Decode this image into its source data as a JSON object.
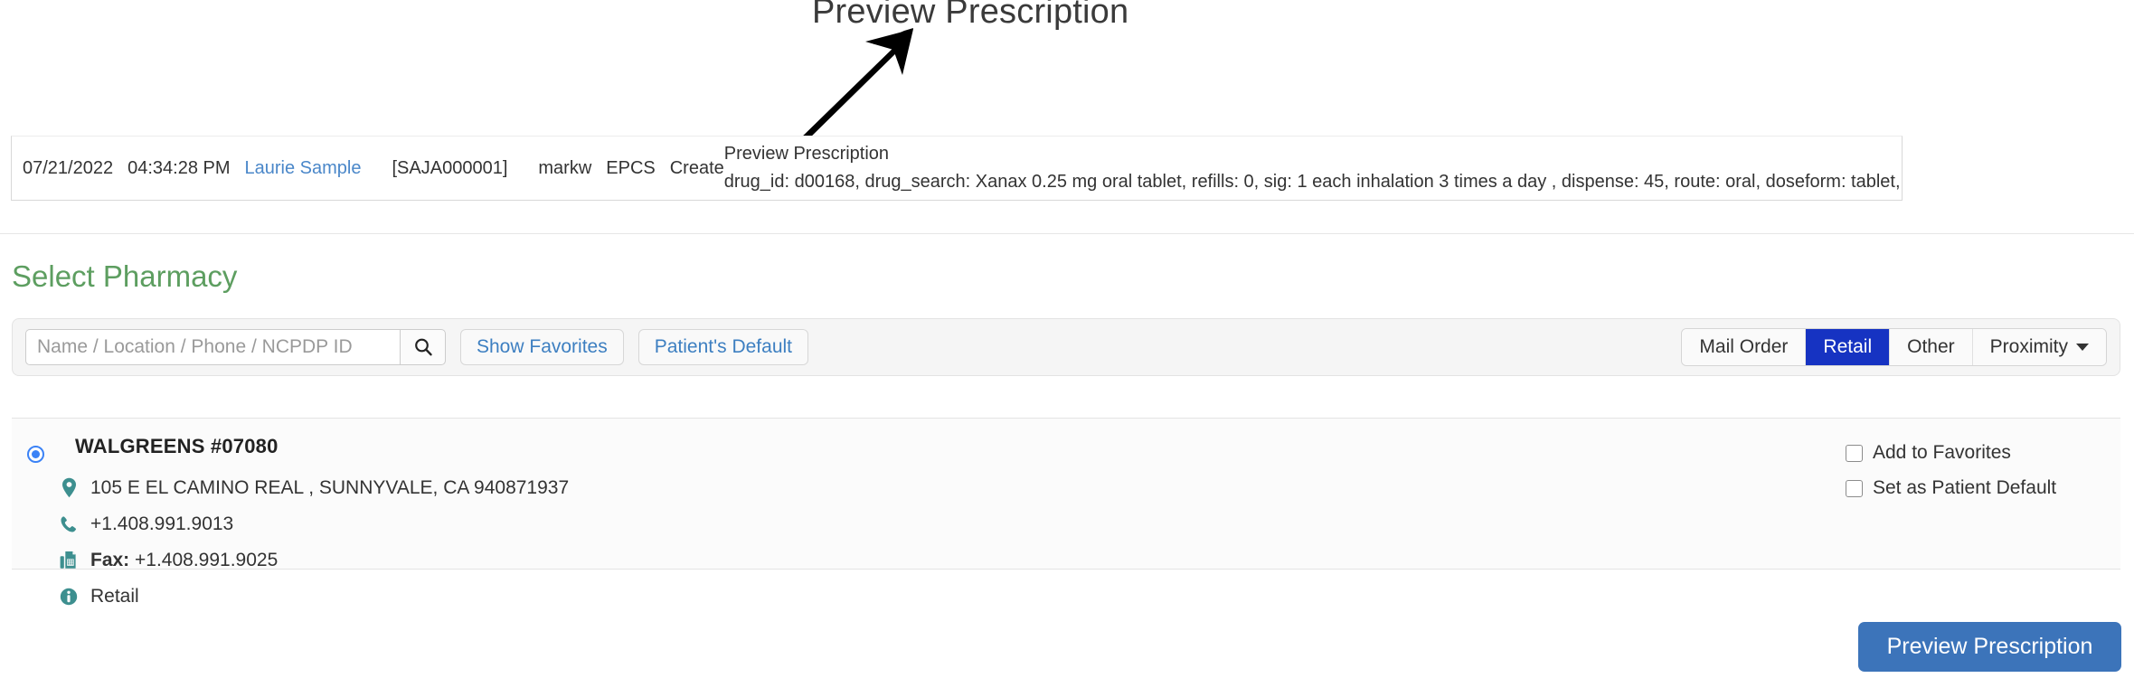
{
  "annotation": {
    "label": "Preview Prescription",
    "arrow_icon": "arrow-up-right-icon"
  },
  "audit_log": {
    "date": "07/21/2022",
    "time": "04:34:28 PM",
    "patient_name": "Laurie Sample",
    "patient_id": "[SAJA000001]",
    "user": "markw",
    "category": "EPCS",
    "action": "Create",
    "event_title": "Preview Prescription",
    "event_detail": "drug_id: d00168, drug_search: Xanax 0.25 mg oral tablet, refills: 0, sig: 1 each inhalation 3 times a day , dispense: 45, route: oral, doseform: tablet, dispense_as_written"
  },
  "page": {
    "title": "Select Pharmacy",
    "title_color": "#5d9e60"
  },
  "search": {
    "placeholder": "Name / Location / Phone / NCPDP ID",
    "value": "",
    "icon": "search-icon"
  },
  "filter_buttons": [
    {
      "label": "Show Favorites",
      "name": "show-favorites-button"
    },
    {
      "label": "Patient's Default",
      "name": "patients-default-button"
    }
  ],
  "type_toggle": {
    "active_color": "#1633c2",
    "options": [
      {
        "label": "Mail Order",
        "active": false
      },
      {
        "label": "Retail",
        "active": true
      },
      {
        "label": "Other",
        "active": false
      }
    ],
    "proximity_label": "Proximity",
    "proximity_icon": "chevron-down-icon"
  },
  "pharmacy": {
    "selected": true,
    "name": "WALGREENS #07080",
    "address": "105 E EL CAMINO REAL , SUNNYVALE, CA 940871937",
    "phone": "+1.408.991.9013",
    "fax_label": "Fax:",
    "fax": "+1.408.991.9025",
    "type": "Retail",
    "icon_color": "#3d8f8f",
    "icons": {
      "address": "map-pin-icon",
      "phone": "phone-icon",
      "fax": "fax-icon",
      "type": "info-circle-icon"
    },
    "checkboxes": [
      {
        "label": "Add to Favorites",
        "checked": false
      },
      {
        "label": "Set as Patient Default",
        "checked": false
      }
    ]
  },
  "footer": {
    "primary_button": "Preview Prescription",
    "primary_color": "#3c74ba"
  }
}
